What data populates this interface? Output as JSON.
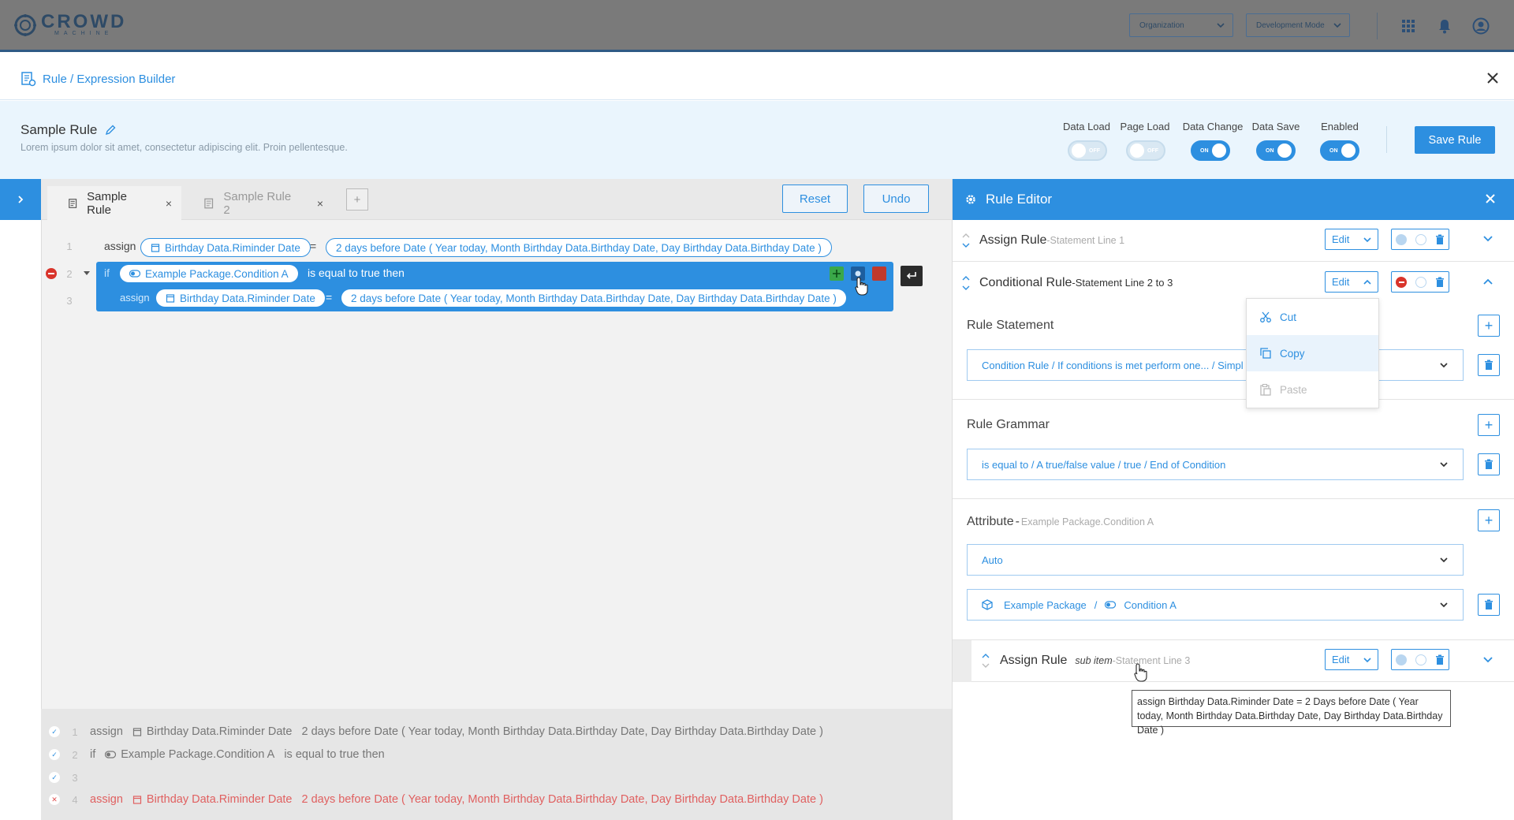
{
  "topbar": {
    "logo_text": "CROWD",
    "logo_sub": "MACHINE",
    "org_select": "Organization",
    "mode_select": "Development Mode",
    "apps_icon": "grid-icon",
    "notif_icon": "bell-icon",
    "user_icon": "user-icon"
  },
  "header": {
    "title": "Rule / Expression Builder"
  },
  "rule": {
    "name": "Sample Rule",
    "description": "Lorem ipsum dolor sit amet, consectetur adipiscing elit. Proin pellentesque.",
    "toggles": [
      {
        "label": "Data Load",
        "state": "OFF"
      },
      {
        "label": "Page Load",
        "state": "OFF"
      },
      {
        "label": "Data Change",
        "state": "ON"
      },
      {
        "label": "Data Save",
        "state": "ON"
      },
      {
        "label": "Enabled",
        "state": "ON"
      }
    ],
    "save_label": "Save Rule"
  },
  "tabs": [
    {
      "label": "Sample Rule",
      "close": "×"
    },
    {
      "label": "Sample Rule 2",
      "close": "×"
    }
  ],
  "toolbar": {
    "add": "+",
    "reset": "Reset",
    "undo": "Undo"
  },
  "code": {
    "line1": {
      "num": "1",
      "kw": "assign",
      "attr": "Birthday Data.Riminder Date",
      "op": "=",
      "expr": "2 days before Date ( Year today, Month Birthday Data.Birthday Date, Day Birthday Data.Birthday Date )"
    },
    "line2": {
      "num": "2",
      "kw": "if",
      "cond": "Example Package.Condition A",
      "tail": "is equal to true then"
    },
    "line3": {
      "num": "3",
      "kw": "assign",
      "attr": "Birthday Data.Riminder Date",
      "op": "=",
      "expr": "2 days before Date ( Year today, Month Birthday Data.Birthday Date, Day Birthday Data.Birthday Date )"
    }
  },
  "summary": [
    {
      "num": "1",
      "kw": "assign",
      "attr": "Birthday Data.Riminder Date",
      "expr": "2 days before Date ( Year today, Month Birthday Data.Birthday Date, Day Birthday Data.Birthday Date )",
      "status": "ok"
    },
    {
      "num": "2",
      "kw": "if",
      "attr": "Example Package.Condition A",
      "expr": "is equal to true then",
      "status": "ok"
    },
    {
      "num": "3",
      "kw": "",
      "attr": "",
      "expr": "",
      "status": "ok"
    },
    {
      "num": "4",
      "kw": "assign",
      "attr": "Birthday Data.Riminder Date",
      "expr": "2 days before Date ( Year today, Month Birthday Data.Birthday Date, Day Birthday Data.Birthday Date )",
      "status": "error"
    }
  ],
  "editor": {
    "title": "Rule Editor",
    "rows": [
      {
        "title": "Assign Rule",
        "sep": " - ",
        "sub": "Statement Line 1",
        "edit": "Edit"
      },
      {
        "title": "Conditional Rule",
        "sep": " - ",
        "sub": "Statement Line 2 to 3",
        "edit": "Edit"
      },
      {
        "title": "Assign Rule",
        "subitem": "sub item",
        "sep": " - ",
        "sub": "Statement Line 3",
        "edit": "Edit"
      }
    ],
    "rule_statement": {
      "label": "Rule Statement",
      "value": "Condition Rule  /  If conditions is met perform one...  /  Simpl"
    },
    "rule_grammar": {
      "label": "Rule Grammar",
      "value": "is equal to  /  A true/false value  /  true  /  End of Condition"
    },
    "attribute": {
      "label": "Attribute",
      "sep": " - ",
      "sub": "Example Package.Condition A",
      "mode": "Auto",
      "package": "Example Package",
      "slash": "/",
      "condition": "Condition A"
    },
    "menu": [
      {
        "label": "Cut",
        "state": "normal"
      },
      {
        "label": "Copy",
        "state": "hover"
      },
      {
        "label": "Paste",
        "state": "disabled"
      }
    ],
    "tooltip": "assign Birthday Data.Riminder Date = 2 Days before Date ( Year today, Month Birthday Data.Birthday Date, Day Birthday Data.Birthday Date )"
  },
  "colors": {
    "accent": "#2d8fe0",
    "error": "#e05050",
    "topbar": "#7a7a7a"
  }
}
